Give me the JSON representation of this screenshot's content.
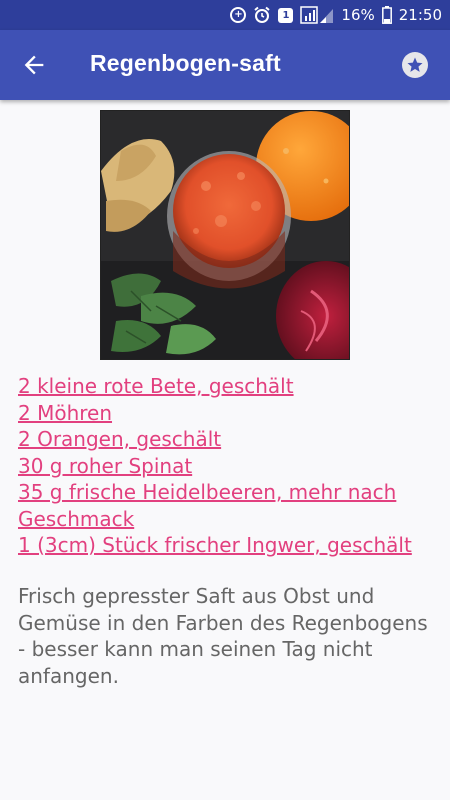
{
  "status_bar": {
    "battery_percent": "16%",
    "time": "21:50",
    "notification_badge": "1",
    "icons": [
      "sync-icon",
      "alarm-icon",
      "notification-icon",
      "signal-icon",
      "battery-icon"
    ]
  },
  "app_bar": {
    "title": "Regenbogen-saft",
    "back_icon": "arrow-left-icon",
    "favorite_icon": "star-icon"
  },
  "recipe": {
    "ingredients": [
      "2 kleine rote Bete, geschält",
      "2 Möhren",
      "2 Orangen, geschält",
      "30 g roher Spinat",
      "35 g frische Heidelbeeren, mehr nach Geschmack",
      "1 (3cm) Stück frischer Ingwer, geschält"
    ],
    "description": "Frisch gepresster Saft aus Obst und Gemüse in den Farben des Regenbogens - besser kann man seinen Tag nicht anfangen."
  },
  "colors": {
    "status_bar": "#2e3e9b",
    "app_bar": "#3f51b5",
    "ingredient_link": "#e2407f",
    "description_text": "#666666"
  }
}
